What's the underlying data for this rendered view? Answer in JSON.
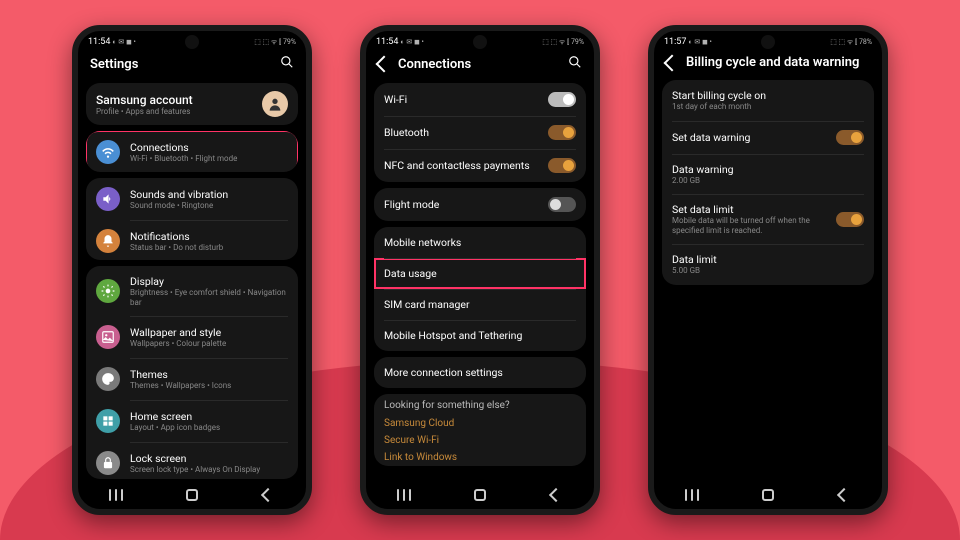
{
  "phones": [
    {
      "status": {
        "time": "11:54",
        "icons": "◐ ✉ ◼ •",
        "right": "⬚ ⬚ ᯤ ⫿ 79%"
      },
      "title": "Settings",
      "account": {
        "title": "Samsung account",
        "sub": "Profile • Apps and features"
      },
      "groups": [
        {
          "items": [
            {
              "icon": "wifi",
              "color": "ic-blue",
              "title": "Connections",
              "sub": "Wi-Fi • Bluetooth • Flight mode",
              "highlight": true
            }
          ]
        },
        {
          "items": [
            {
              "icon": "sound",
              "color": "ic-purple",
              "title": "Sounds and vibration",
              "sub": "Sound mode • Ringtone"
            },
            {
              "icon": "bell",
              "color": "ic-orange",
              "title": "Notifications",
              "sub": "Status bar • Do not disturb"
            }
          ]
        },
        {
          "items": [
            {
              "icon": "display",
              "color": "ic-green",
              "title": "Display",
              "sub": "Brightness • Eye comfort shield • Navigation bar"
            },
            {
              "icon": "wallpaper",
              "color": "ic-pink",
              "title": "Wallpaper and style",
              "sub": "Wallpapers • Colour palette"
            },
            {
              "icon": "themes",
              "color": "ic-grey",
              "title": "Themes",
              "sub": "Themes • Wallpapers • Icons"
            },
            {
              "icon": "home",
              "color": "ic-teal",
              "title": "Home screen",
              "sub": "Layout • App icon badges"
            },
            {
              "icon": "lock",
              "color": "ic-grey2",
              "title": "Lock screen",
              "sub": "Screen lock type • Always On Display"
            }
          ]
        }
      ]
    },
    {
      "status": {
        "time": "11:54",
        "icons": "◐ ✉ ◼ •",
        "right": "⬚ ⬚ ᯤ ⫿ 79%"
      },
      "title": "Connections",
      "back": true,
      "groups": [
        {
          "items": [
            {
              "title": "Wi-Fi",
              "toggle": "on-white"
            },
            {
              "title": "Bluetooth",
              "toggle": "on"
            },
            {
              "title": "NFC and contactless payments",
              "toggle": "on"
            }
          ]
        },
        {
          "items": [
            {
              "title": "Flight mode",
              "toggle": "off"
            }
          ]
        },
        {
          "items": [
            {
              "title": "Mobile networks"
            },
            {
              "title": "Data usage",
              "highlight": true
            },
            {
              "title": "SIM card manager"
            },
            {
              "title": "Mobile Hotspot and Tethering"
            }
          ]
        },
        {
          "items": [
            {
              "title": "More connection settings"
            }
          ]
        }
      ],
      "help": {
        "head": "Looking for something else?",
        "links": [
          "Samsung Cloud",
          "Secure Wi-Fi",
          "Link to Windows"
        ]
      }
    },
    {
      "status": {
        "time": "11:57",
        "icons": "◐ ✉ ◼ •",
        "right": "⬚ ⬚ ᯤ ⫿ 78%"
      },
      "title": "Billing cycle and data warning",
      "back": true,
      "nosearch": true,
      "groups": [
        {
          "items": [
            {
              "title": "Start billing cycle on",
              "sub": "1st day of each month"
            },
            {
              "title": "Set data warning",
              "toggle": "on"
            },
            {
              "title": "Data warning",
              "sub": "2.00 GB"
            },
            {
              "title": "Set data limit",
              "sub": "Mobile data will be turned off when the specified limit is reached.",
              "toggle": "on"
            },
            {
              "title": "Data limit",
              "sub": "5.00 GB"
            }
          ]
        }
      ]
    }
  ]
}
